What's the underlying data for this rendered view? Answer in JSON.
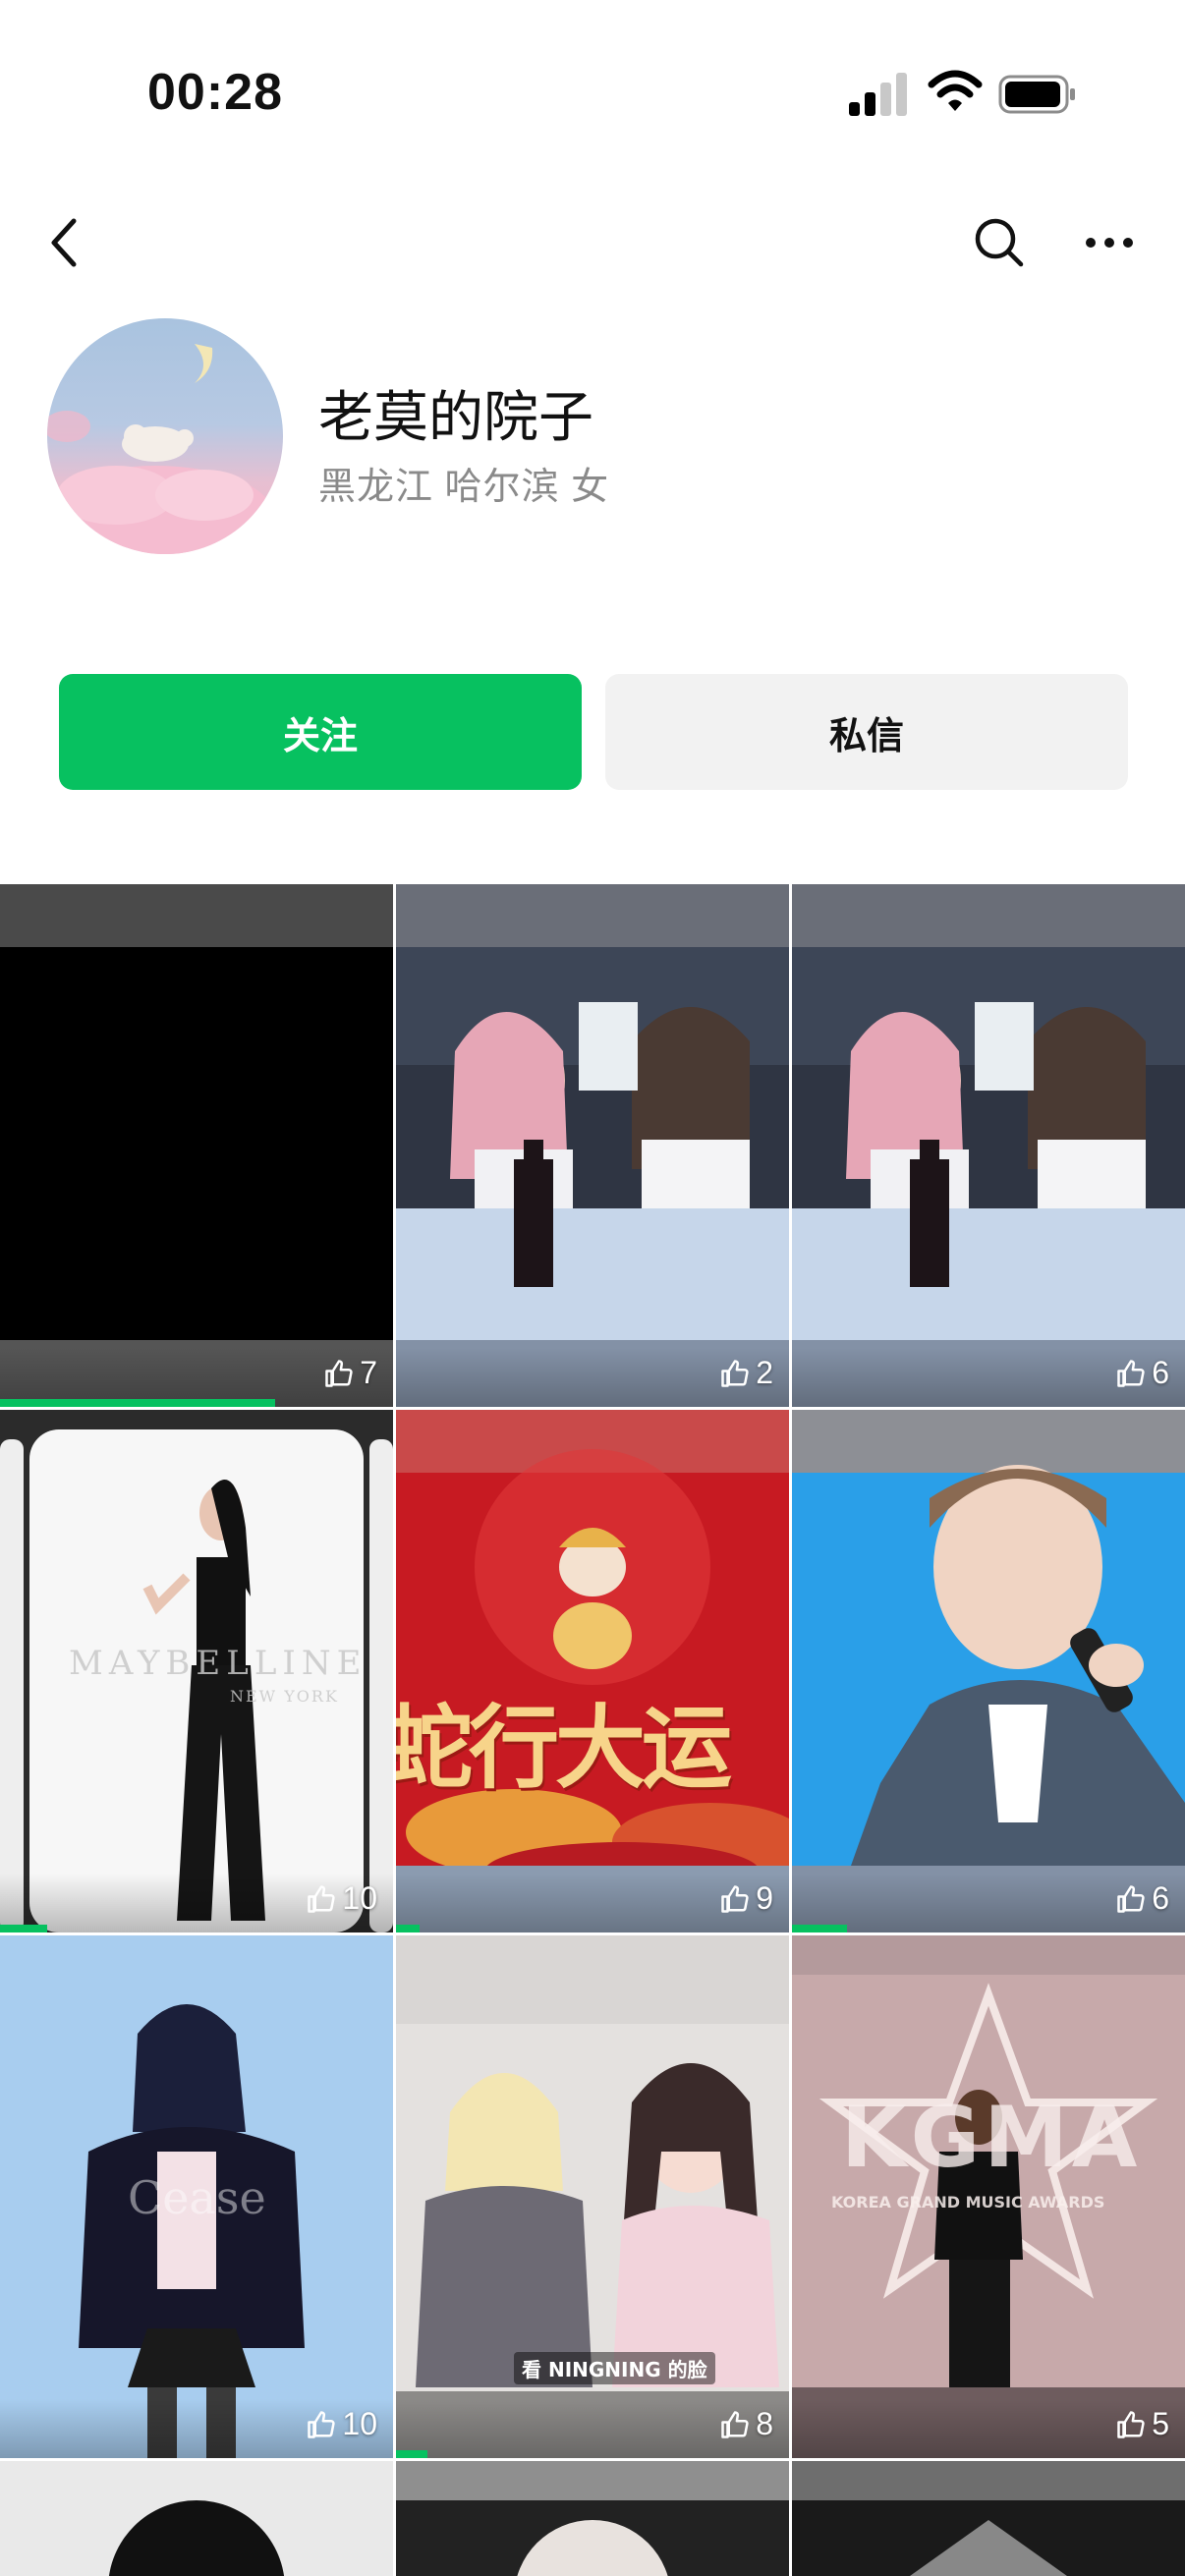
{
  "status_bar": {
    "time": "00:28",
    "icons": [
      "cellular-signal-icon",
      "wifi-icon",
      "battery-icon"
    ]
  },
  "nav": {
    "back_icon": "chevron-left-icon",
    "search_icon": "search-icon",
    "more_icon": "more-horizontal-icon"
  },
  "profile": {
    "name": "老莫的院子",
    "meta": "黑龙江 哈尔滨 女"
  },
  "actions": {
    "follow_label": "关注",
    "message_label": "私信"
  },
  "colors": {
    "accent": "#07c160",
    "button_secondary": "#f2f2f2",
    "meta_text": "#8a8a8a"
  },
  "grid": {
    "like_icon": "thumbs-up-icon",
    "tiles": [
      {
        "likes": "7",
        "progress": 0.7
      },
      {
        "likes": "2"
      },
      {
        "likes": "6"
      },
      {
        "likes": "10",
        "progress": 0.12,
        "overlay": "MAYBELLINE",
        "overlay_sub": "NEW YORK"
      },
      {
        "likes": "9",
        "progress": 0.06,
        "overlay": "蛇行大运"
      },
      {
        "likes": "6",
        "progress": 0.14
      },
      {
        "likes": "10",
        "overlay": "Cease"
      },
      {
        "likes": "8",
        "caption": "看 NINGNING 的脸"
      },
      {
        "likes": "5",
        "overlay": "KGMA",
        "overlay_sub": "KOREA GRAND MUSIC AWARDS"
      }
    ]
  }
}
